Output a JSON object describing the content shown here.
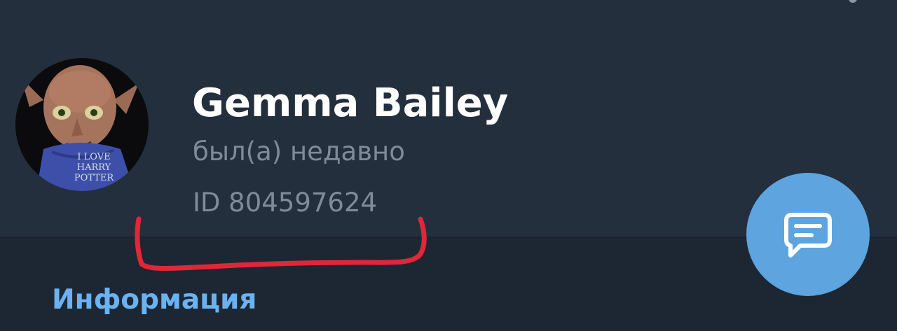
{
  "profile": {
    "name": "Gemma Bailey",
    "status": "был(а) недавно",
    "user_id": "ID 804597624",
    "avatar": {
      "icon": "avatar-photo",
      "shirt_text": [
        "I LOVE",
        "HARRY",
        "POTTER"
      ]
    }
  },
  "section": {
    "title": "Информация"
  },
  "actions": {
    "message_button_icon": "chat-bubble-icon"
  },
  "colors": {
    "header_bg": "#242f3d",
    "body_bg": "#1d2733",
    "accent": "#6ab2f2",
    "fab": "#5ea5e0",
    "annotation": "#e0273a"
  }
}
